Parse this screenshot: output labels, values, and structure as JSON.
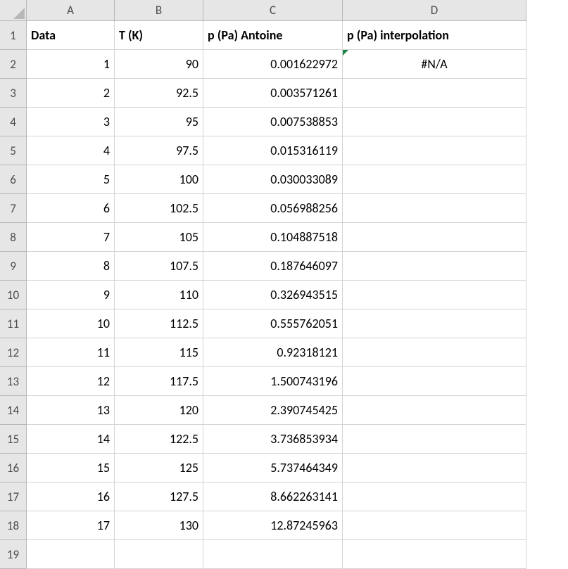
{
  "columns": [
    "A",
    "B",
    "C",
    "D"
  ],
  "row_labels": [
    "1",
    "2",
    "3",
    "4",
    "5",
    "6",
    "7",
    "8",
    "9",
    "10",
    "11",
    "12",
    "13",
    "14",
    "15",
    "16",
    "17",
    "18",
    "19"
  ],
  "headers": {
    "c1": "Data",
    "c2": "T (K)",
    "c3": "p (Pa) Antoine",
    "c4": "p (Pa) interpolation"
  },
  "rows": [
    {
      "d": "1",
      "t": "90",
      "p": "0.001622972",
      "i": "#N/A"
    },
    {
      "d": "2",
      "t": "92.5",
      "p": "0.003571261",
      "i": ""
    },
    {
      "d": "3",
      "t": "95",
      "p": "0.007538853",
      "i": ""
    },
    {
      "d": "4",
      "t": "97.5",
      "p": "0.015316119",
      "i": ""
    },
    {
      "d": "5",
      "t": "100",
      "p": "0.030033089",
      "i": ""
    },
    {
      "d": "6",
      "t": "102.5",
      "p": "0.056988256",
      "i": ""
    },
    {
      "d": "7",
      "t": "105",
      "p": "0.104887518",
      "i": ""
    },
    {
      "d": "8",
      "t": "107.5",
      "p": "0.187646097",
      "i": ""
    },
    {
      "d": "9",
      "t": "110",
      "p": "0.326943515",
      "i": ""
    },
    {
      "d": "10",
      "t": "112.5",
      "p": "0.555762051",
      "i": ""
    },
    {
      "d": "11",
      "t": "115",
      "p": "0.92318121",
      "i": ""
    },
    {
      "d": "12",
      "t": "117.5",
      "p": "1.500743196",
      "i": ""
    },
    {
      "d": "13",
      "t": "120",
      "p": "2.390745425",
      "i": ""
    },
    {
      "d": "14",
      "t": "122.5",
      "p": "3.736853934",
      "i": ""
    },
    {
      "d": "15",
      "t": "125",
      "p": "5.737464349",
      "i": ""
    },
    {
      "d": "16",
      "t": "127.5",
      "p": "8.662263141",
      "i": ""
    },
    {
      "d": "17",
      "t": "130",
      "p": "12.87245963",
      "i": ""
    }
  ]
}
